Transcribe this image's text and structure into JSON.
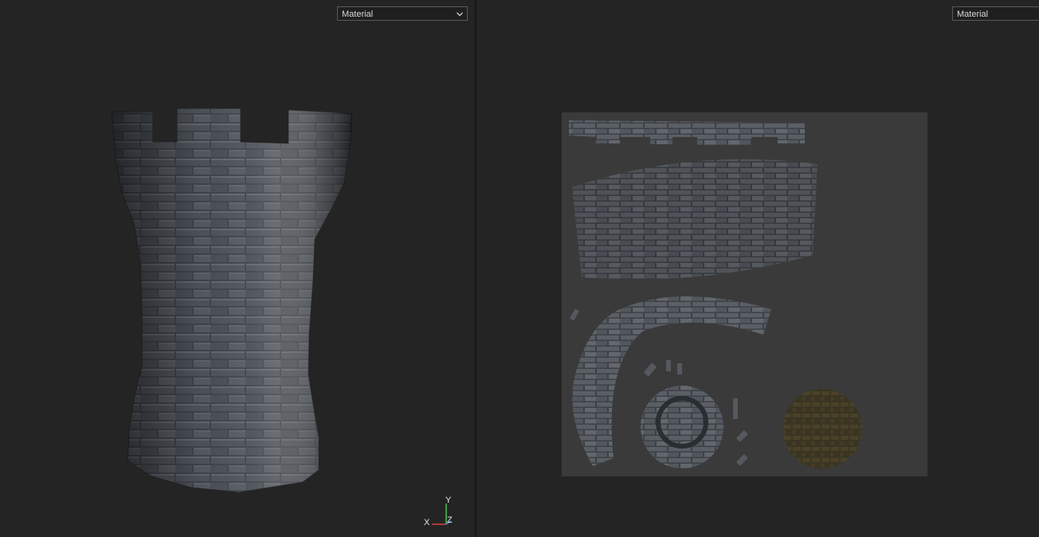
{
  "viewport_3d": {
    "material_select": {
      "value": "Material"
    },
    "axis_gizmo": {
      "x_label": "X",
      "y_label": "Y",
      "z_label": "Z"
    },
    "icons": {
      "dropdown_chevron": "chevron-down-icon",
      "axis_gizmo": "axis-gizmo-icon"
    }
  },
  "viewport_uv": {
    "material_select": {
      "value": "Material"
    }
  },
  "colors": {
    "background": "#242424",
    "divider": "#151515",
    "uv_canvas": "#3a3a3a",
    "stone": "#4a4f55",
    "mortar": "#1c1d1e",
    "axis_x": "#d94040",
    "axis_y": "#4fc04f",
    "axis_z": "#3d7fd9"
  }
}
